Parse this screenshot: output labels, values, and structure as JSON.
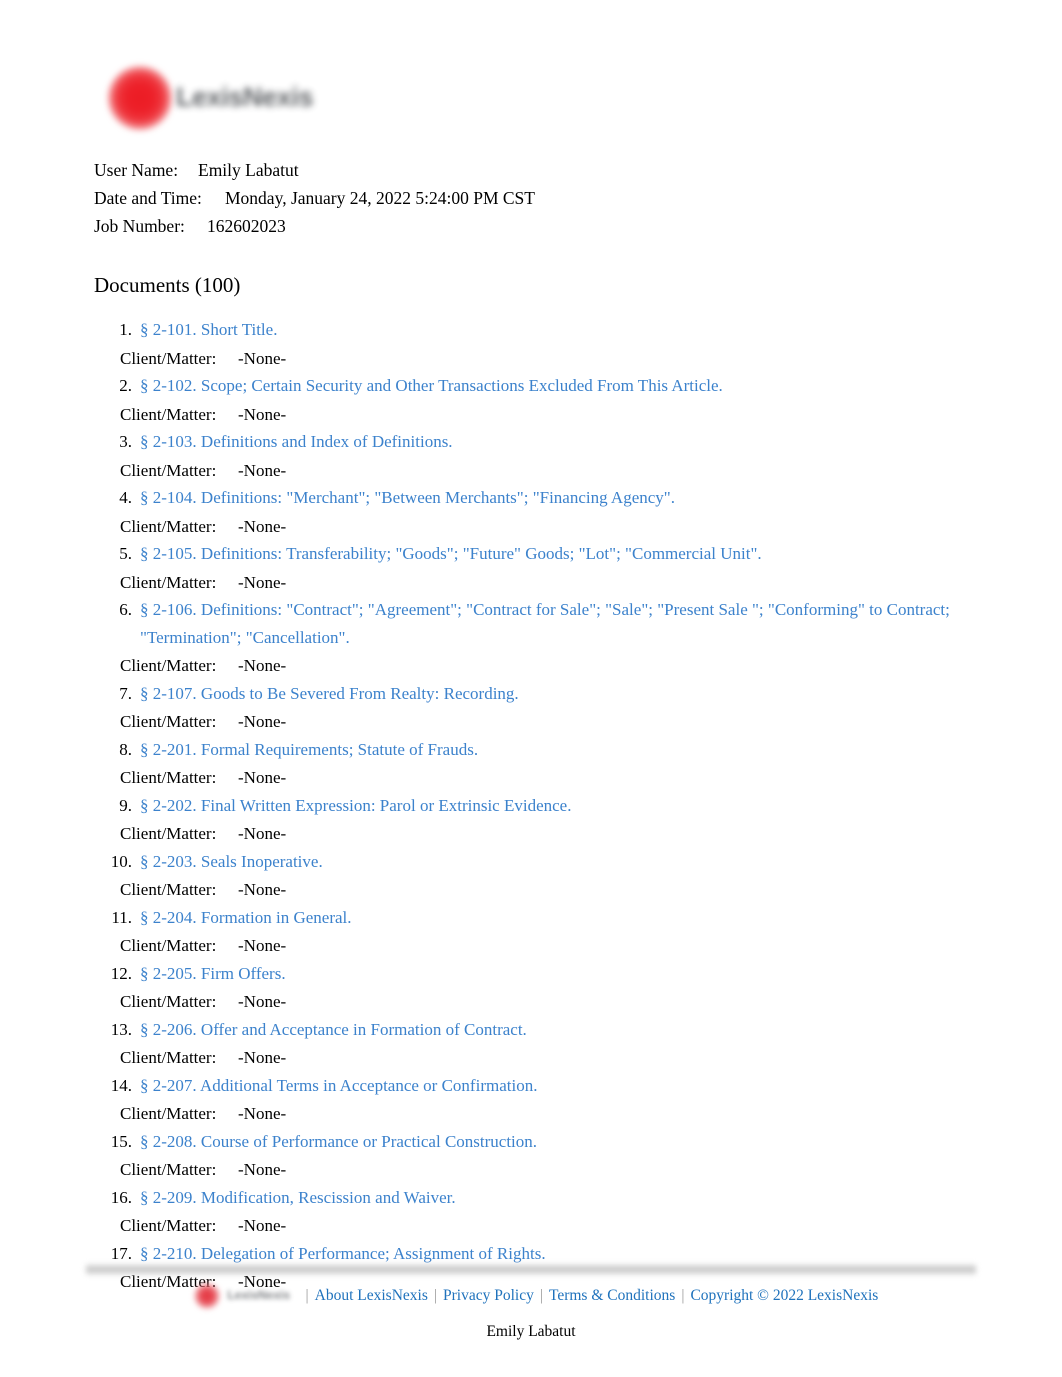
{
  "brand": {
    "logo_name": "lexisnexis-logo",
    "wordmark": "LexisNexis",
    "accent_red": "#ec1c24",
    "link_blue": "#3c82cc",
    "footer_link_blue": "#1f72bc"
  },
  "meta": {
    "user_name_label": "User Name:",
    "user_name_value": "Emily Labatut",
    "date_time_label": "Date and Time:",
    "date_time_value": "Monday, January 24, 2022 5:24:00 PM CST",
    "job_number_label": "Job Number:",
    "job_number_value": "162602023"
  },
  "documents": {
    "heading": "Documents (100)",
    "client_matter_label": "Client/Matter:",
    "client_matter_value": "-None-",
    "items": [
      {
        "num": "1.",
        "title": "§ 2-101. Short Title."
      },
      {
        "num": "2.",
        "title": "§ 2-102. Scope; Certain Security and Other Transactions Excluded From This Article."
      },
      {
        "num": "3.",
        "title": "§ 2-103. Definitions and Index of Definitions."
      },
      {
        "num": "4.",
        "title": "§ 2-104. Definitions: \"Merchant\"; \"Between Merchants\"; \"Financing Agency\"."
      },
      {
        "num": "5.",
        "title": "§ 2-105. Definitions: Transferability; \"Goods\"; \"Future\" Goods; \"Lot\"; \"Commercial Unit\"."
      },
      {
        "num": "6.",
        "title": "§ 2-106. Definitions: \"Contract\"; \"Agreement\"; \"Contract for Sale\"; \"Sale\"; \"Present Sale \"; \"Conforming\" to Contract; \"Termination\"; \"Cancellation\"."
      },
      {
        "num": "7.",
        "title": "§ 2-107. Goods to Be Severed From Realty: Recording."
      },
      {
        "num": "8.",
        "title": "§ 2-201. Formal Requirements; Statute of Frauds."
      },
      {
        "num": "9.",
        "title": "§ 2-202. Final Written Expression: Parol or Extrinsic Evidence."
      },
      {
        "num": "10.",
        "title": "§ 2-203. Seals Inoperative."
      },
      {
        "num": "11.",
        "title": "§ 2-204. Formation in General."
      },
      {
        "num": "12.",
        "title": "§ 2-205. Firm Offers."
      },
      {
        "num": "13.",
        "title": "§ 2-206. Offer and Acceptance in Formation of Contract."
      },
      {
        "num": "14.",
        "title": "§ 2-207. Additional Terms in Acceptance or Confirmation."
      },
      {
        "num": "15.",
        "title": "§ 2-208. Course of Performance or Practical Construction."
      },
      {
        "num": "16.",
        "title": "§ 2-209. Modification, Rescission and Waiver."
      },
      {
        "num": "17.",
        "title": "§ 2-210. Delegation of Performance; Assignment of Rights."
      }
    ]
  },
  "footer": {
    "logo_name": "lexisnexis-footer-logo",
    "separator": "|",
    "links": [
      "About LexisNexis",
      "Privacy Policy",
      "Terms & Conditions",
      "Copyright © 2022 LexisNexis"
    ],
    "user_name": "Emily Labatut"
  }
}
